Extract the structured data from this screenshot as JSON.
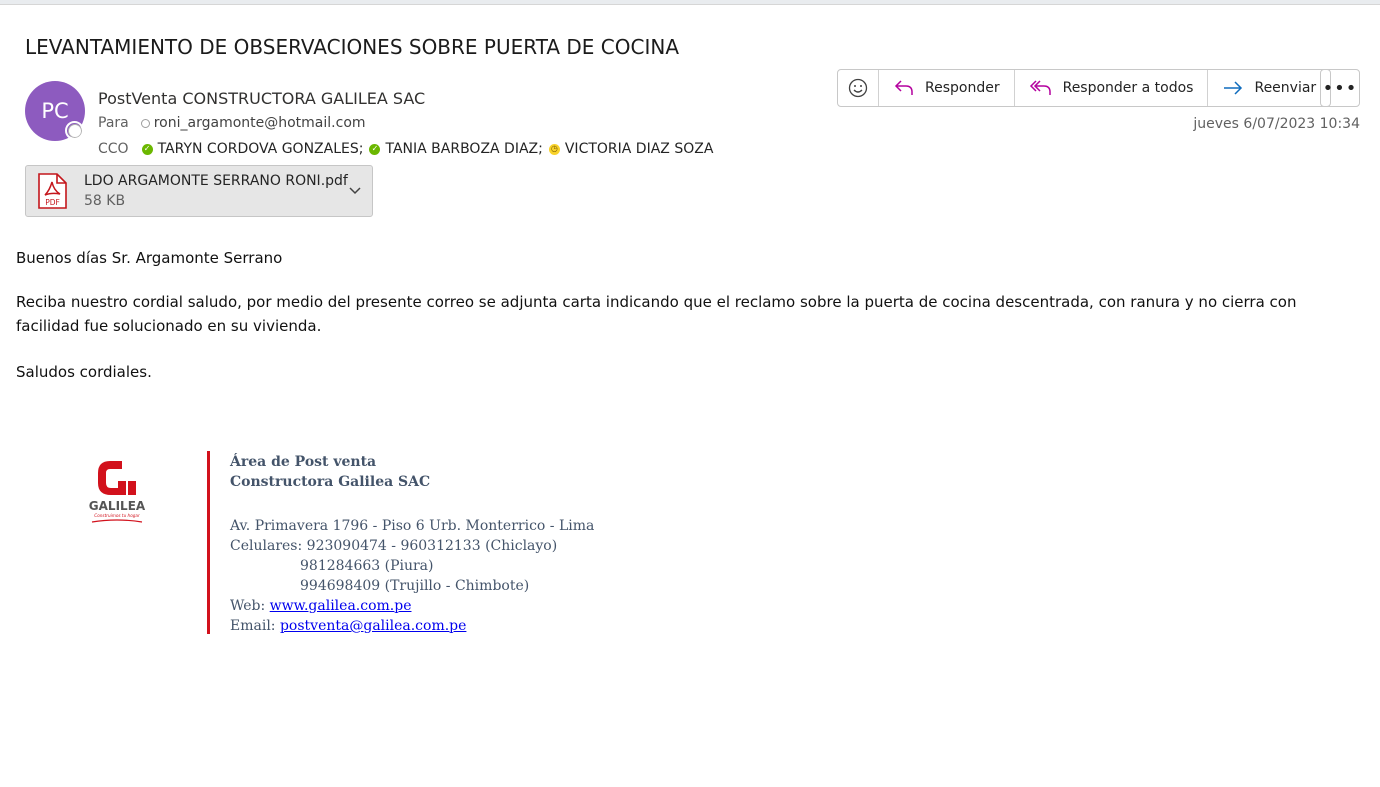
{
  "email": {
    "subject": "LEVANTAMIENTO DE OBSERVACIONES SOBRE PUERTA DE COCINA",
    "avatar_initials": "PC",
    "sender": "PostVenta CONSTRUCTORA GALILEA SAC",
    "to_label": "Para",
    "to": "roni_argamonte@hotmail.com",
    "cco_label": "CCO",
    "cco": [
      {
        "name": "TARYN CORDOVA GONZALES;",
        "status": "available"
      },
      {
        "name": "TANIA BARBOZA DIAZ;",
        "status": "available"
      },
      {
        "name": "VICTORIA DIAZ SOZA",
        "status": "away"
      }
    ],
    "date": "jueves 6/07/2023 10:34"
  },
  "actions": {
    "reply": "Responder",
    "reply_all": "Responder a todos",
    "forward": "Reenviar",
    "more": "•••"
  },
  "attachment": {
    "name": "LDO ARGAMONTE SERRANO RONI.pdf",
    "size": "58 KB",
    "icon_label": "PDF"
  },
  "body": {
    "greeting": "Buenos días Sr. Argamonte Serrano",
    "paragraph": "Reciba nuestro cordial saludo, por medio del presente correo se adjunta carta indicando que el reclamo sobre la puerta de cocina descentrada, con ranura y no cierra con facilidad fue solucionado en su vivienda.",
    "closing": "Saludos cordiales."
  },
  "signature": {
    "logo_text": "GALILEA",
    "logo_tagline": "Construimos tu hogar",
    "dept": "Área de Post venta",
    "company": "Constructora Galilea SAC",
    "address": "Av. Primavera 1796 - Piso 6 Urb. Monterrico - Lima",
    "phones_label": "Celulares: ",
    "phones_1": "923090474 - 960312133 (Chiclayo)",
    "phones_2": "981284663 (Piura)",
    "phones_3": "994698409 (Trujillo - Chimbote)",
    "web_label": "Web: ",
    "web": "www.galilea.com.pe",
    "email_label": "Email: ",
    "email": "postventa@galilea.com.pe"
  },
  "colors": {
    "avatar": "#8d5bbf",
    "accent_red": "#d2111c",
    "reply_icon": "#b4009e",
    "forward_icon": "#0f6cbd"
  }
}
